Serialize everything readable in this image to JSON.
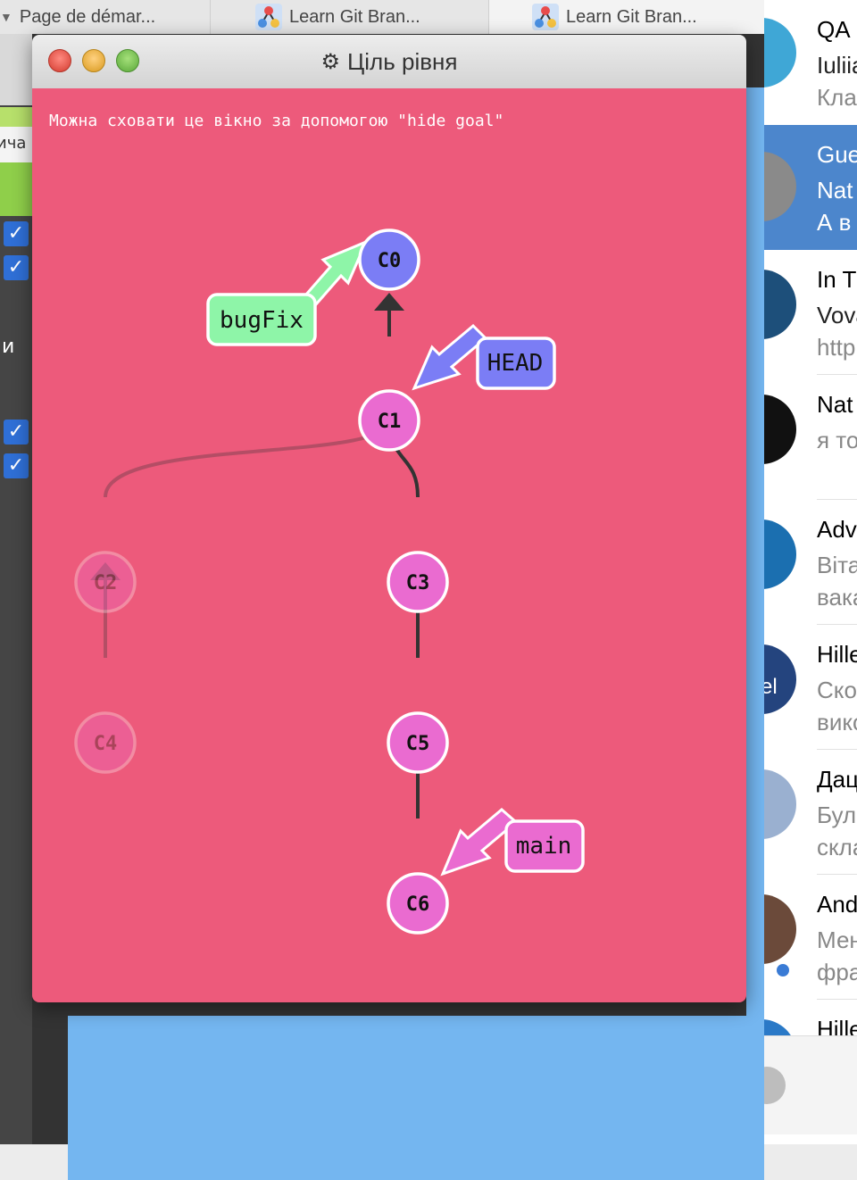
{
  "browser": {
    "tabs": [
      {
        "label": "Page de démar..."
      },
      {
        "label": "Learn Git Bran..."
      },
      {
        "label": "Learn Git Bran..."
      }
    ]
  },
  "background_app": {
    "partial_text_1": "ича",
    "partial_text_2": "и"
  },
  "dialog": {
    "title": "Ціль рівня",
    "hint": "Можна сховати це вікно за допомогою \"hide goal\"",
    "commits": [
      {
        "id": "C0",
        "color": "#7b7df5",
        "faded": false
      },
      {
        "id": "C1",
        "color": "#ea6bd0",
        "faded": false
      },
      {
        "id": "C2",
        "color": "#ea6bd0",
        "faded": true
      },
      {
        "id": "C3",
        "color": "#ea6bd0",
        "faded": false
      },
      {
        "id": "C4",
        "color": "#ea6bd0",
        "faded": true
      },
      {
        "id": "C5",
        "color": "#ea6bd0",
        "faded": false
      },
      {
        "id": "C6",
        "color": "#ea6bd0",
        "faded": false
      }
    ],
    "branches": [
      {
        "name": "bugFix",
        "target": "C0",
        "color": "#8ef5a8"
      },
      {
        "name": "HEAD",
        "target": "C1",
        "color": "#7b7df5"
      },
      {
        "name": "main",
        "target": "C6",
        "color": "#ea6bd0"
      }
    ]
  },
  "chat_list": {
    "items": [
      {
        "name": "QA",
        "line2": "Iuliia",
        "line3": "Кла"
      },
      {
        "name": "Gue",
        "line2": "Nat",
        "line3": "А в",
        "selected": true
      },
      {
        "name": "In T",
        "line2": "Vova",
        "line3": "http"
      },
      {
        "name": "Nat",
        "line2": "я то",
        "line3": ""
      },
      {
        "name": "Adv",
        "line2": "Віта",
        "line3": "вака"
      },
      {
        "name": "Hille",
        "line2": "Ско",
        "line3": "вико"
      },
      {
        "name": "Дац",
        "line2": "Буле",
        "line3": "скла"
      },
      {
        "name": "And",
        "line2": "Мен",
        "line3": "фра"
      },
      {
        "name": "Hille",
        "line2": "",
        "line3": ""
      }
    ],
    "avatar_texts": [
      "el"
    ]
  }
}
